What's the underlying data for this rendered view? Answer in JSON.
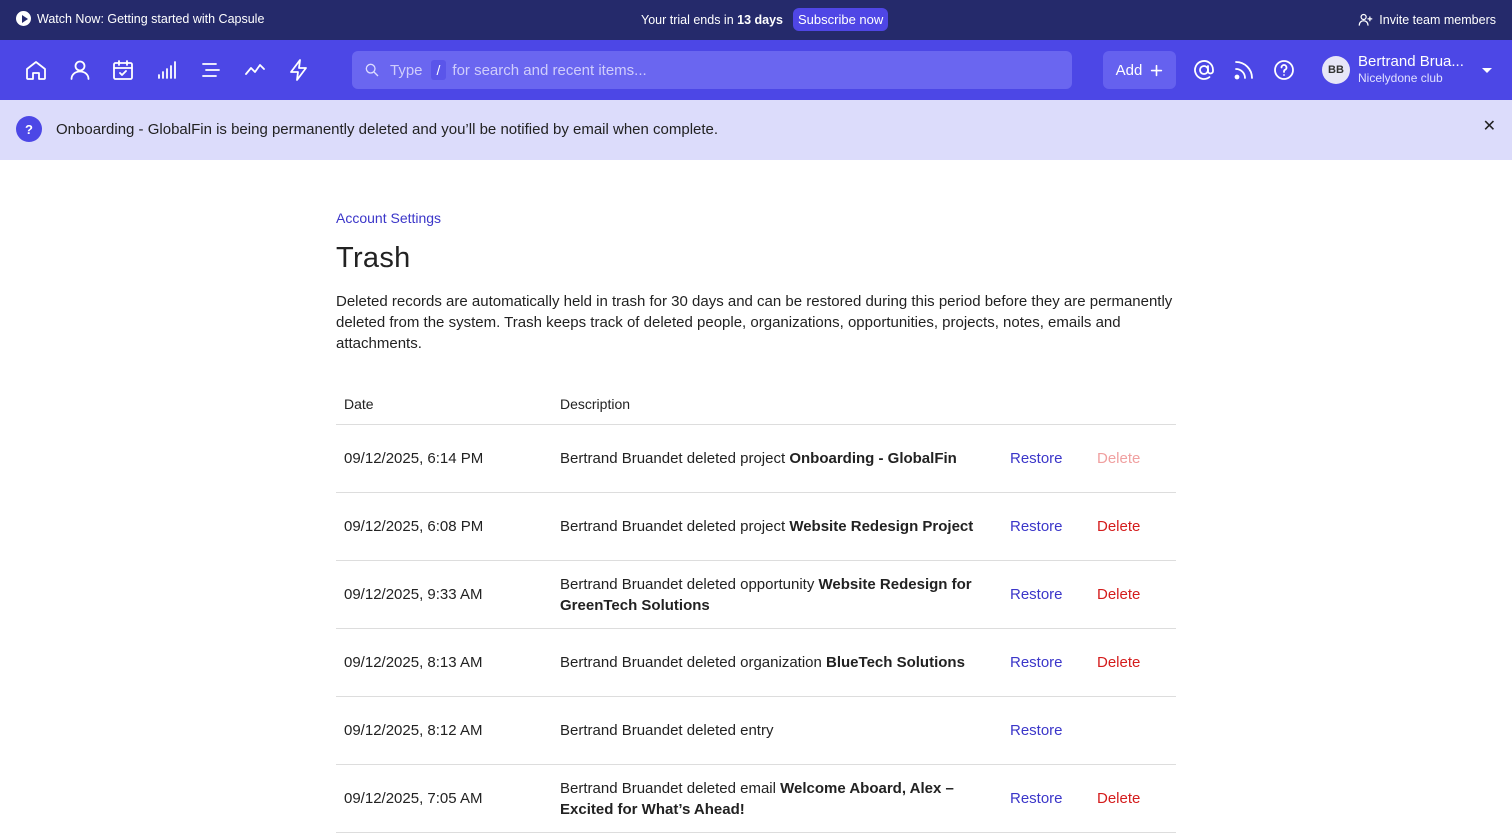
{
  "topbar": {
    "watch_label": "Watch Now: Getting started with Capsule",
    "trial_prefix": "Your trial ends in",
    "trial_days": "13 days",
    "subscribe_label": "Subscribe now",
    "invite_label": "Invite team members"
  },
  "nav": {
    "icons": [
      "home-icon",
      "person-icon",
      "calendar-check-icon",
      "bar-chart-icon",
      "list-icon",
      "trend-line-icon",
      "lightning-icon"
    ],
    "search": {
      "placeholder_prefix": "Type",
      "key": "/",
      "placeholder_suffix": "for search and recent items..."
    },
    "add_label": "Add",
    "user": {
      "initials": "BB",
      "name": "Bertrand Brua...",
      "org": "Nicelydone club"
    }
  },
  "notice": {
    "icon": "?",
    "text": "Onboarding - GlobalFin is being permanently deleted and you’ll be notified by email when complete."
  },
  "page": {
    "breadcrumb": "Account Settings",
    "title": "Trash",
    "intro": "Deleted records are automatically held in trash for 30 days and can be restored during this period before they are permanently deleted from the system. Trash keeps track of deleted people, organizations, opportunities, projects, notes, emails and attachments."
  },
  "table": {
    "headers": {
      "date": "Date",
      "description": "Description"
    },
    "restore_label": "Restore",
    "delete_label": "Delete",
    "rows": [
      {
        "date": "09/12/2025, 6:14 PM",
        "prefix": "Bertrand Bruandet deleted project ",
        "item": "Onboarding - GlobalFin",
        "can_delete": true,
        "delete_pending": true
      },
      {
        "date": "09/12/2025, 6:08 PM",
        "prefix": "Bertrand Bruandet deleted project ",
        "item": "Website Redesign Project",
        "can_delete": true,
        "delete_pending": false
      },
      {
        "date": "09/12/2025, 9:33 AM",
        "prefix": "Bertrand Bruandet deleted opportunity ",
        "item": "Website Redesign for GreenTech Solutions",
        "can_delete": true,
        "delete_pending": false
      },
      {
        "date": "09/12/2025, 8:13 AM",
        "prefix": "Bertrand Bruandet deleted organization ",
        "item": "BlueTech Solutions",
        "can_delete": true,
        "delete_pending": false
      },
      {
        "date": "09/12/2025, 8:12 AM",
        "prefix": "Bertrand Bruandet deleted entry",
        "item": "",
        "can_delete": false,
        "delete_pending": false
      },
      {
        "date": "09/12/2025, 7:05 AM",
        "prefix": "Bertrand Bruandet deleted email ",
        "item": "Welcome Aboard, Alex – Excited for What’s Ahead!",
        "can_delete": true,
        "delete_pending": false
      }
    ]
  },
  "colors": {
    "topbar": "#252a6b",
    "navbar": "#4c47e6",
    "notice": "#dcdcfb",
    "link": "#3b36c9",
    "danger": "#d41c1c"
  }
}
